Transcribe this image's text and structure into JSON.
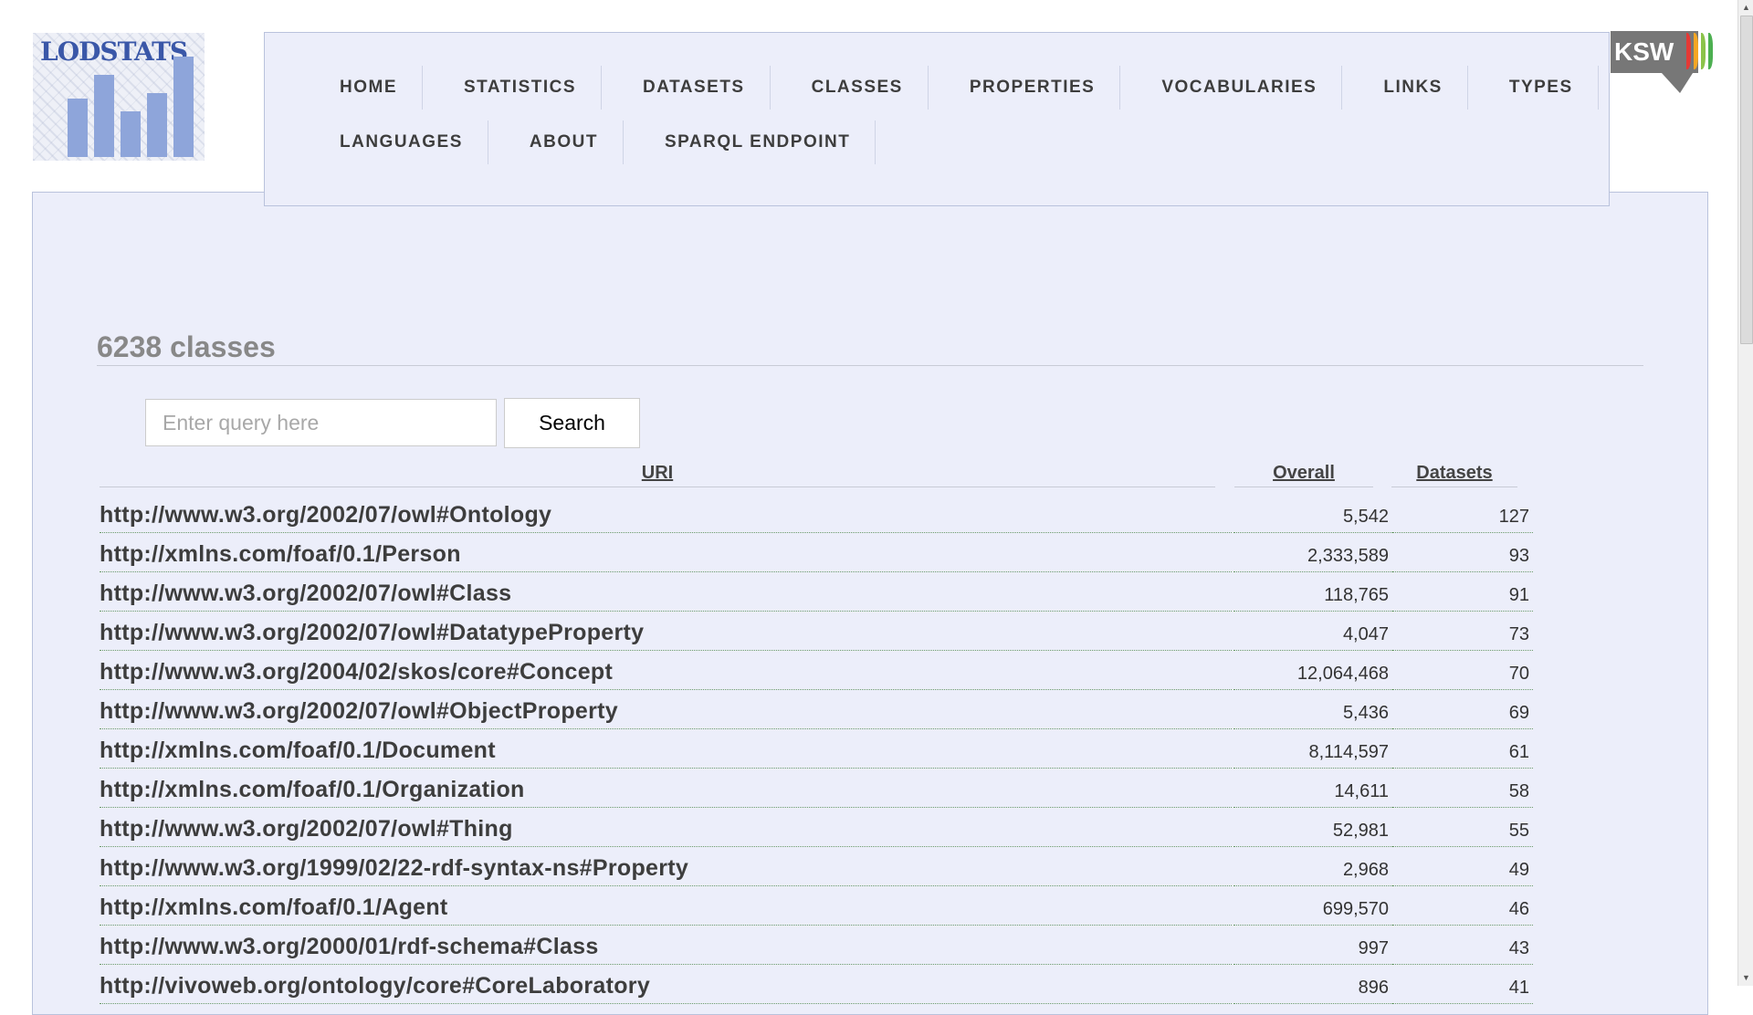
{
  "logo": {
    "text": "LODSTATS"
  },
  "ksw_logo": {
    "text": "KSW"
  },
  "nav": {
    "row1": [
      "HOME",
      "STATISTICS",
      "DATASETS",
      "CLASSES",
      "PROPERTIES",
      "VOCABULARIES",
      "LINKS",
      "TYPES"
    ],
    "row2": [
      "LANGUAGES",
      "ABOUT",
      "SPARQL ENDPOINT"
    ]
  },
  "page_title": "6238 classes",
  "search": {
    "placeholder": "Enter query here",
    "button_label": "Search"
  },
  "table": {
    "headers": {
      "uri": "URI",
      "overall": "Overall",
      "datasets": "Datasets"
    },
    "rows": [
      {
        "uri": "http://www.w3.org/2002/07/owl#Ontology",
        "overall": "5,542",
        "datasets": "127"
      },
      {
        "uri": "http://xmlns.com/foaf/0.1/Person",
        "overall": "2,333,589",
        "datasets": "93"
      },
      {
        "uri": "http://www.w3.org/2002/07/owl#Class",
        "overall": "118,765",
        "datasets": "91"
      },
      {
        "uri": "http://www.w3.org/2002/07/owl#DatatypeProperty",
        "overall": "4,047",
        "datasets": "73"
      },
      {
        "uri": "http://www.w3.org/2004/02/skos/core#Concept",
        "overall": "12,064,468",
        "datasets": "70"
      },
      {
        "uri": "http://www.w3.org/2002/07/owl#ObjectProperty",
        "overall": "5,436",
        "datasets": "69"
      },
      {
        "uri": "http://xmlns.com/foaf/0.1/Document",
        "overall": "8,114,597",
        "datasets": "61"
      },
      {
        "uri": "http://xmlns.com/foaf/0.1/Organization",
        "overall": "14,611",
        "datasets": "58"
      },
      {
        "uri": "http://www.w3.org/2002/07/owl#Thing",
        "overall": "52,981",
        "datasets": "55"
      },
      {
        "uri": "http://www.w3.org/1999/02/22-rdf-syntax-ns#Property",
        "overall": "2,968",
        "datasets": "49"
      },
      {
        "uri": "http://xmlns.com/foaf/0.1/Agent",
        "overall": "699,570",
        "datasets": "46"
      },
      {
        "uri": "http://www.w3.org/2000/01/rdf-schema#Class",
        "overall": "997",
        "datasets": "43"
      },
      {
        "uri": "http://vivoweb.org/ontology/core#CoreLaboratory",
        "overall": "896",
        "datasets": "41"
      }
    ]
  },
  "colors": {
    "panel_bg": "#eceefa",
    "panel_border": "#b9c2dc",
    "row_rule": "#6a9a6a",
    "logo_blue": "#3a57a8",
    "ksw_stripes": [
      "#e53935",
      "#f5a623",
      "#8bc34a",
      "#4caf50"
    ]
  }
}
